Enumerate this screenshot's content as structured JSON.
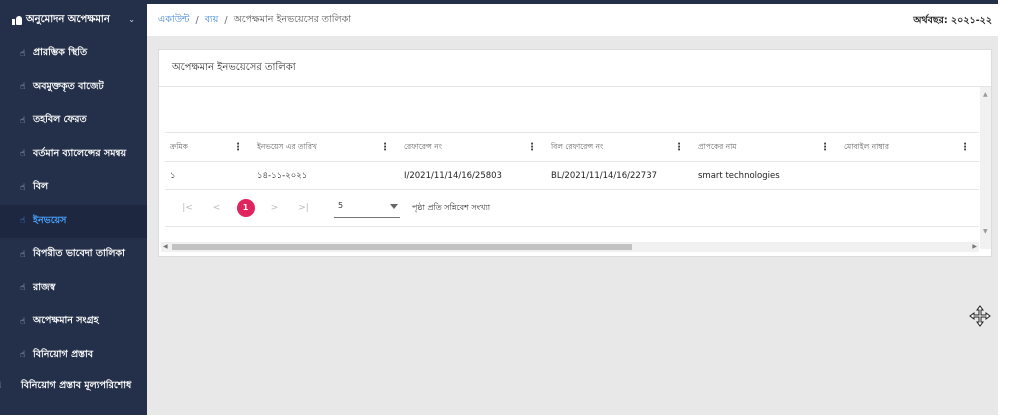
{
  "sidebar": {
    "header": "অনুমোদন অপেক্ষমান",
    "items": [
      {
        "label": "প্রারম্ভিক স্থিতি",
        "active": false
      },
      {
        "label": "অবমুক্তকৃত বাজেট",
        "active": false
      },
      {
        "label": "তহবিল ফেরত",
        "active": false
      },
      {
        "label": "বর্তমান ব্যালেন্সের সমন্বয়",
        "active": false
      },
      {
        "label": "বিল",
        "active": false
      },
      {
        "label": "ইনভয়েস",
        "active": true
      },
      {
        "label": "বিপরীত ভাবেদা তালিকা",
        "active": false
      },
      {
        "label": "রাজস্ব",
        "active": false
      },
      {
        "label": "অপেক্ষমান সংগ্রহ",
        "active": false
      },
      {
        "label": "বিনিয়োগ প্রস্তাব",
        "active": false
      },
      {
        "label": "বিনিয়োগ প্রস্তাব মূল্যপরিশোধ",
        "active": false
      }
    ]
  },
  "breadcrumb": {
    "items": [
      "একাউন্ট",
      "ব্যয়",
      "অপেক্ষমান ইনভয়েসের তালিকা"
    ],
    "separator": "/"
  },
  "fiscal_year": "অর্থবছর: ২০২১-২২",
  "card": {
    "title": "অপেক্ষমান ইনভয়েসের তালিকা",
    "columns": [
      "ক্রমিক",
      "ইনভয়েস এর তারিখ",
      "রেফারেন্স নং",
      "বিল রেফারেন্স নং",
      "প্রাপকের নাম",
      "মোবাইল নাম্বার"
    ],
    "rows": [
      [
        "১",
        "১৪-১১-২০২১",
        "I/2021/11/14/16/25803",
        "BL/2021/11/14/16/22737",
        "smart technologies",
        ""
      ]
    ],
    "pagination": {
      "first": "|<",
      "prev": "<",
      "current": "1",
      "next": ">",
      "last": ">|",
      "rows_per_page": "5",
      "rows_per_page_label": "পৃষ্ঠা প্রতি সন্নিবেশ সংখ্যা"
    }
  },
  "colors": {
    "sidebar_bg": "#243049",
    "active_link": "#4aa3ff",
    "breadcrumb_link": "#3b82d6",
    "pager_active": "#e0245e"
  }
}
